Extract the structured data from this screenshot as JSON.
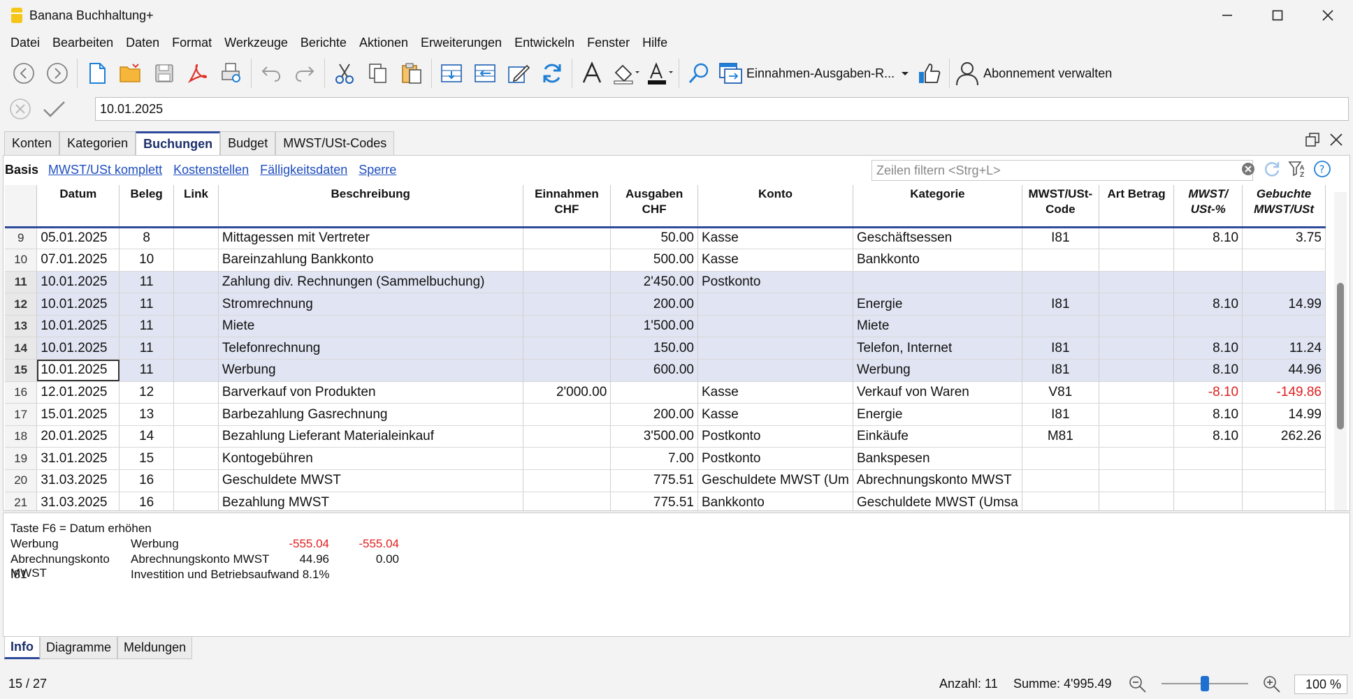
{
  "window": {
    "title": "Banana Buchhaltung+"
  },
  "menu": [
    "Datei",
    "Bearbeiten",
    "Daten",
    "Format",
    "Werkzeuge",
    "Berichte",
    "Aktionen",
    "Erweiterungen",
    "Entwickeln",
    "Fenster",
    "Hilfe"
  ],
  "toolbar": {
    "layout_name": "Einnahmen-Ausgaben-R...",
    "subscription": "Abonnement verwalten"
  },
  "cell_editor": {
    "value": "10.01.2025"
  },
  "tabs": [
    "Konten",
    "Kategorien",
    "Buchungen",
    "Budget",
    "MWST/USt-Codes"
  ],
  "views": [
    "Basis",
    "MWST/USt komplett",
    "Kostenstellen",
    "Fälligkeitsdaten",
    "Sperre"
  ],
  "filter": {
    "placeholder": "Zeilen filtern <Strg+L>"
  },
  "columns": [
    {
      "l1": "Datum",
      "l2": ""
    },
    {
      "l1": "Beleg",
      "l2": ""
    },
    {
      "l1": "Link",
      "l2": ""
    },
    {
      "l1": "Beschreibung",
      "l2": ""
    },
    {
      "l1": "Einnahmen",
      "l2": "CHF"
    },
    {
      "l1": "Ausgaben",
      "l2": "CHF"
    },
    {
      "l1": "Konto",
      "l2": ""
    },
    {
      "l1": "Kategorie",
      "l2": ""
    },
    {
      "l1": "MWST/USt-",
      "l2": "Code"
    },
    {
      "l1": "Art Betrag",
      "l2": ""
    },
    {
      "l1": "MWST/",
      "l2": "USt-%"
    },
    {
      "l1": "Gebuchte",
      "l2": "MWST/USt"
    }
  ],
  "rows": [
    {
      "n": "9",
      "datum": "05.01.2025",
      "beleg": "8",
      "link": "",
      "beschreibung": "Mittagessen mit Vertreter",
      "einnahmen": "",
      "ausgaben": "50.00",
      "konto": "Kasse",
      "kategorie": "Geschäftsessen",
      "code": "I81",
      "art": "",
      "pct": "8.10",
      "mwst": "3.75",
      "sel": false,
      "neg": false
    },
    {
      "n": "10",
      "datum": "07.01.2025",
      "beleg": "10",
      "link": "",
      "beschreibung": "Bareinzahlung Bankkonto",
      "einnahmen": "",
      "ausgaben": "500.00",
      "konto": "Kasse",
      "kategorie": "Bankkonto",
      "code": "",
      "art": "",
      "pct": "",
      "mwst": "",
      "sel": false,
      "neg": false
    },
    {
      "n": "11",
      "datum": "10.01.2025",
      "beleg": "11",
      "link": "",
      "beschreibung": "Zahlung div. Rechnungen (Sammelbuchung)",
      "einnahmen": "",
      "ausgaben": "2'450.00",
      "konto": "Postkonto",
      "kategorie": "",
      "code": "",
      "art": "",
      "pct": "",
      "mwst": "",
      "sel": true,
      "neg": false
    },
    {
      "n": "12",
      "datum": "10.01.2025",
      "beleg": "11",
      "link": "",
      "beschreibung": "Stromrechnung",
      "einnahmen": "",
      "ausgaben": "200.00",
      "konto": "",
      "kategorie": "Energie",
      "code": "I81",
      "art": "",
      "pct": "8.10",
      "mwst": "14.99",
      "sel": true,
      "neg": false
    },
    {
      "n": "13",
      "datum": "10.01.2025",
      "beleg": "11",
      "link": "",
      "beschreibung": "Miete",
      "einnahmen": "",
      "ausgaben": "1'500.00",
      "konto": "",
      "kategorie": "Miete",
      "code": "",
      "art": "",
      "pct": "",
      "mwst": "",
      "sel": true,
      "neg": false
    },
    {
      "n": "14",
      "datum": "10.01.2025",
      "beleg": "11",
      "link": "",
      "beschreibung": "Telefonrechnung",
      "einnahmen": "",
      "ausgaben": "150.00",
      "konto": "",
      "kategorie": "Telefon, Internet",
      "code": "I81",
      "art": "",
      "pct": "8.10",
      "mwst": "11.24",
      "sel": true,
      "neg": false
    },
    {
      "n": "15",
      "datum": "10.01.2025",
      "beleg": "11",
      "link": "",
      "beschreibung": "Werbung",
      "einnahmen": "",
      "ausgaben": "600.00",
      "konto": "",
      "kategorie": "Werbung",
      "code": "I81",
      "art": "",
      "pct": "8.10",
      "mwst": "44.96",
      "sel": true,
      "neg": false
    },
    {
      "n": "16",
      "datum": "12.01.2025",
      "beleg": "12",
      "link": "",
      "beschreibung": "Barverkauf von Produkten",
      "einnahmen": "2'000.00",
      "ausgaben": "",
      "konto": "Kasse",
      "kategorie": "Verkauf von Waren",
      "code": "V81",
      "art": "",
      "pct": "-8.10",
      "mwst": "-149.86",
      "sel": false,
      "neg": true
    },
    {
      "n": "17",
      "datum": "15.01.2025",
      "beleg": "13",
      "link": "",
      "beschreibung": "Barbezahlung Gasrechnung",
      "einnahmen": "",
      "ausgaben": "200.00",
      "konto": "Kasse",
      "kategorie": "Energie",
      "code": "I81",
      "art": "",
      "pct": "8.10",
      "mwst": "14.99",
      "sel": false,
      "neg": false
    },
    {
      "n": "18",
      "datum": "20.01.2025",
      "beleg": "14",
      "link": "",
      "beschreibung": "Bezahlung Lieferant Materialeinkauf",
      "einnahmen": "",
      "ausgaben": "3'500.00",
      "konto": "Postkonto",
      "kategorie": "Einkäufe",
      "code": "M81",
      "art": "",
      "pct": "8.10",
      "mwst": "262.26",
      "sel": false,
      "neg": false
    },
    {
      "n": "19",
      "datum": "31.01.2025",
      "beleg": "15",
      "link": "",
      "beschreibung": "Kontogebühren",
      "einnahmen": "",
      "ausgaben": "7.00",
      "konto": "Postkonto",
      "kategorie": "Bankspesen",
      "code": "",
      "art": "",
      "pct": "",
      "mwst": "",
      "sel": false,
      "neg": false
    },
    {
      "n": "20",
      "datum": "31.03.2025",
      "beleg": "16",
      "link": "",
      "beschreibung": "Geschuldete MWST",
      "einnahmen": "",
      "ausgaben": "775.51",
      "konto": "Geschuldete MWST (Um",
      "kategorie": "Abrechnungskonto MWST",
      "code": "",
      "art": "",
      "pct": "",
      "mwst": "",
      "sel": false,
      "neg": false
    },
    {
      "n": "21",
      "datum": "31.03.2025",
      "beleg": "16",
      "link": "",
      "beschreibung": "Bezahlung MWST",
      "einnahmen": "",
      "ausgaben": "775.51",
      "konto": "Bankkonto",
      "kategorie": "Geschuldete MWST (Umsa",
      "code": "",
      "art": "",
      "pct": "",
      "mwst": "",
      "sel": false,
      "neg": false
    }
  ],
  "info": {
    "hint": "Taste F6 = Datum erhöhen",
    "lines": [
      {
        "a": "Werbung",
        "b": "Werbung",
        "c": "-555.04",
        "d": "-555.04",
        "neg": true
      },
      {
        "a": "Abrechnungskonto MWST",
        "b": "Abrechnungskonto MWST",
        "c": "44.96",
        "d": "0.00",
        "neg": false
      },
      {
        "a": "I81",
        "b": "Investition und Betriebsaufwand 8.1%",
        "c": "",
        "d": "",
        "neg": false
      }
    ]
  },
  "bottom_tabs": [
    "Info",
    "Diagramme",
    "Meldungen"
  ],
  "status": {
    "position": "15 / 27",
    "count": "Anzahl: 11",
    "sum": "Summe: 4'995.49",
    "zoom": "100 %"
  },
  "colors": {
    "accent": "#2e4a9a",
    "selected_row": "#e1e5f3",
    "negative": "#e02020",
    "link": "#1f4fbf"
  }
}
